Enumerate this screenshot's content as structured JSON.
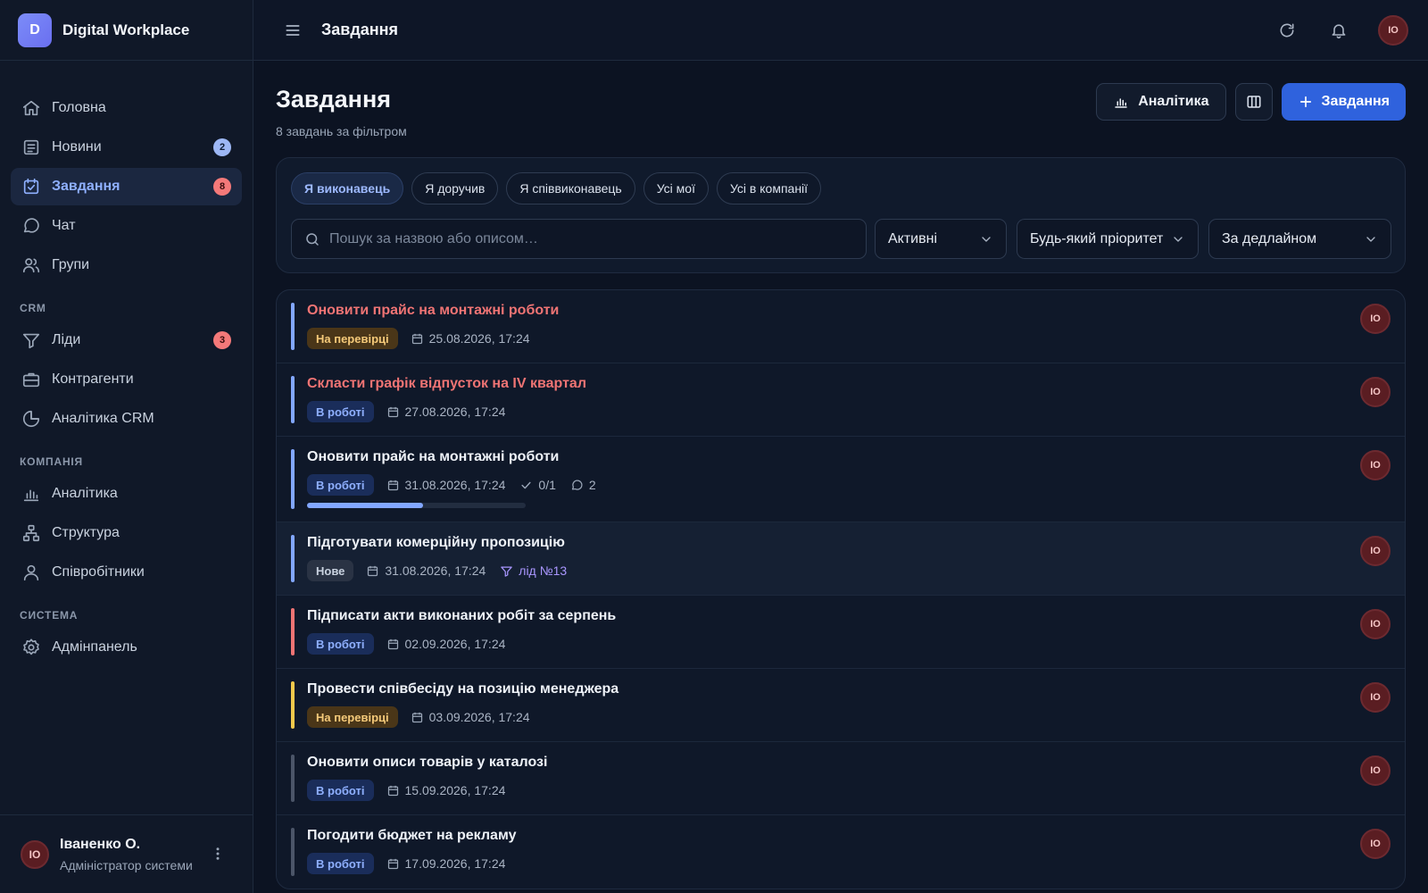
{
  "brand": {
    "logo_letter": "D",
    "name": "Digital Workplace"
  },
  "sidebar": {
    "main_items": [
      {
        "label": "Головна",
        "icon": "home-icon"
      },
      {
        "label": "Новини",
        "icon": "news-icon",
        "badge": "2"
      },
      {
        "label": "Завдання",
        "icon": "tasks-icon",
        "badge": "8",
        "active": true
      },
      {
        "label": "Чат",
        "icon": "chat-icon"
      },
      {
        "label": "Групи",
        "icon": "groups-icon"
      }
    ],
    "crm_title": "CRM",
    "crm_items": [
      {
        "label": "Ліди",
        "icon": "filter-icon",
        "badge": "3"
      },
      {
        "label": "Контрагенти",
        "icon": "briefcase-icon"
      },
      {
        "label": "Аналітика CRM",
        "icon": "pie-chart-icon"
      }
    ],
    "company_title": "КОМПАНІЯ",
    "company_items": [
      {
        "label": "Аналітика",
        "icon": "bar-chart-icon"
      },
      {
        "label": "Структура",
        "icon": "structure-icon"
      },
      {
        "label": "Співробітники",
        "icon": "user-icon"
      }
    ],
    "system_title": "СИСТЕМА",
    "system_items": [
      {
        "label": "Адмінпанель",
        "icon": "gear-icon"
      }
    ]
  },
  "profile": {
    "initials": "IO",
    "name": "Іваненко О.",
    "role": "Адміністратор системи"
  },
  "topbar": {
    "title": "Завдання",
    "avatar_initials": "IO"
  },
  "page": {
    "title": "Завдання",
    "subtitle": "8 завдань за фільтром",
    "analytics_label": "Аналітика",
    "new_task_label": "Завдання"
  },
  "filters": {
    "chips": [
      "Я виконавець",
      "Я доручив",
      "Я співвиконавець",
      "Усі мої",
      "Усі в компанії"
    ],
    "active_chip": 0,
    "search_placeholder": "Пошук за назвою або описом…",
    "status_select": "Активні",
    "priority_select": "Будь-який пріоритет",
    "sort_select": "За дедлайном"
  },
  "colors": {
    "accent": "#2f62dd",
    "bar_blue": "#82a7ff",
    "bar_red": "#f07474",
    "bar_yellow": "#f2c94c",
    "bar_gray": "#4b5568"
  },
  "tasks": [
    {
      "title": "Оновити прайс на монтажні роботи",
      "overdue": true,
      "status": "На перевірці",
      "status_kind": "review",
      "date": "25.08.2026, 17:24",
      "bar": "blue",
      "assignee": "IO"
    },
    {
      "title": "Скласти графік відпусток на IV квартал",
      "overdue": true,
      "status": "В роботі",
      "status_kind": "work",
      "date": "27.08.2026, 17:24",
      "bar": "blue",
      "assignee": "IO"
    },
    {
      "title": "Оновити прайс на монтажні роботи",
      "overdue": false,
      "status": "В роботі",
      "status_kind": "work",
      "date": "31.08.2026, 17:24",
      "checklist": "0/1",
      "comments": "2",
      "progress": 0.53,
      "bar": "blue",
      "assignee": "IO"
    },
    {
      "title": "Підготувати комерційну пропозицію",
      "overdue": false,
      "status": "Нове",
      "status_kind": "new",
      "date": "31.08.2026, 17:24",
      "lead": "лід №13",
      "bar": "blue",
      "assignee": "IO"
    },
    {
      "title": "Підписати акти виконаних робіт за серпень",
      "overdue": false,
      "status": "В роботі",
      "status_kind": "work",
      "date": "02.09.2026, 17:24",
      "bar": "red",
      "assignee": "IO"
    },
    {
      "title": "Провести співбесіду на позицію менеджера",
      "overdue": false,
      "status": "На перевірці",
      "status_kind": "review",
      "date": "03.09.2026, 17:24",
      "bar": "yellow",
      "assignee": "IO"
    },
    {
      "title": "Оновити описи товарів у каталозі",
      "overdue": false,
      "status": "В роботі",
      "status_kind": "work",
      "date": "15.09.2026, 17:24",
      "bar": "gray",
      "assignee": "IO"
    },
    {
      "title": "Погодити бюджет на рекламу",
      "overdue": false,
      "status": "В роботі",
      "status_kind": "work",
      "date": "17.09.2026, 17:24",
      "bar": "gray",
      "assignee": "IO"
    }
  ]
}
